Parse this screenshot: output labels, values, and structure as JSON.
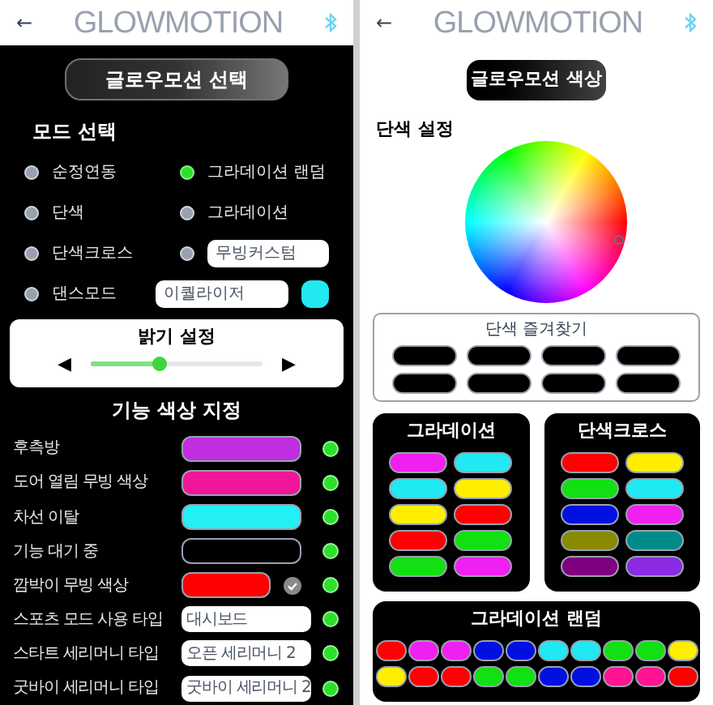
{
  "left": {
    "header": {
      "back": "←",
      "title": "GLOWMOTION"
    },
    "title": "글로우모션 선택",
    "mode_heading": "모드 선택",
    "modes": [
      {
        "kind": "text",
        "label": "순정연동",
        "selected": false
      },
      {
        "kind": "text",
        "label": "그라데이션 랜덤",
        "selected": true
      },
      {
        "kind": "text",
        "label": "단색",
        "selected": false
      },
      {
        "kind": "text",
        "label": "그라데이션",
        "selected": false
      },
      {
        "kind": "text",
        "label": "단색크로스",
        "selected": false
      },
      {
        "kind": "field",
        "value": "무빙커스텀",
        "selected": false
      },
      {
        "kind": "field_swatch",
        "label": "댄스모드",
        "value": "이퀄라이저",
        "color": "#22e8f2",
        "selected": false
      }
    ],
    "brightness": {
      "title": "밝기 설정",
      "left": "◀",
      "right": "▶",
      "level": 0.4
    },
    "function_heading": "기능 색상 지정",
    "functions": [
      {
        "label": "후측방",
        "kind": "swatch",
        "color": "#c02ee0",
        "on": true
      },
      {
        "label": "도어 열림 무빙 색상",
        "kind": "swatch",
        "color": "#f0169a",
        "on": true
      },
      {
        "label": "차선 이탈",
        "kind": "swatch",
        "color": "#22f0f5",
        "on": true
      },
      {
        "label": "기능 대기 중",
        "kind": "swatch",
        "color": "#000000",
        "on": true
      },
      {
        "label": "깜박이 무빙 색상",
        "kind": "swatch_check",
        "color": "#ff0000",
        "on": true
      },
      {
        "label": "스포츠 모드 사용 타입",
        "kind": "field",
        "value": "대시보드",
        "on": true
      },
      {
        "label": "스타트 세리머니 타입",
        "kind": "field",
        "value": "오픈 세리머니 2",
        "on": true
      },
      {
        "label": "굿바이 세리머니 타입",
        "kind": "field",
        "value": "굿바이 세리머니 2",
        "on": true
      }
    ]
  },
  "right": {
    "header": {
      "back": "←",
      "title": "GLOWMOTION"
    },
    "title": "글로우모션 색상",
    "solid_heading": "단색 설정",
    "favorites": {
      "title": "단색 즐겨찾기",
      "slots": [
        {
          "color": "#000000"
        },
        {
          "color": "#000000"
        },
        {
          "color": "#000000"
        },
        {
          "color": "#000000"
        },
        {
          "color": "#000000"
        },
        {
          "color": "#000000"
        },
        {
          "color": "#000000"
        },
        {
          "color": "#000000"
        }
      ]
    },
    "gradient": {
      "title": "그라데이션",
      "swatches": [
        {
          "color": "#f020f0"
        },
        {
          "color": "#22e8f2"
        },
        {
          "color": "#22e8f2"
        },
        {
          "color": "#ffee00"
        },
        {
          "color": "#ffee00"
        },
        {
          "color": "#ff0000"
        },
        {
          "color": "#ff0000"
        },
        {
          "color": "#12e012"
        },
        {
          "color": "#12e012"
        },
        {
          "color": "#f020f0"
        }
      ]
    },
    "cross": {
      "title": "단색크로스",
      "swatches": [
        {
          "color": "#ff0000"
        },
        {
          "color": "#ffee00"
        },
        {
          "color": "#12e012"
        },
        {
          "color": "#22e8f2"
        },
        {
          "color": "#0010e0"
        },
        {
          "color": "#f020f0"
        },
        {
          "color": "#8a8a00"
        },
        {
          "color": "#008b8b"
        },
        {
          "color": "#800080"
        },
        {
          "color": "#8a2be2"
        }
      ]
    },
    "random": {
      "title": "그라데이션 랜덤",
      "swatches": [
        {
          "color": "#ff0000"
        },
        {
          "color": "#f020f0"
        },
        {
          "color": "#f020f0"
        },
        {
          "color": "#0010e0"
        },
        {
          "color": "#0010e0"
        },
        {
          "color": "#22e8f2"
        },
        {
          "color": "#22e8f2"
        },
        {
          "color": "#12e012"
        },
        {
          "color": "#12e012"
        },
        {
          "color": "#ffee00"
        },
        {
          "color": "#ffee00"
        },
        {
          "color": "#ff0000"
        },
        {
          "color": "#ff0000"
        },
        {
          "color": "#12e012"
        },
        {
          "color": "#12e012"
        },
        {
          "color": "#0010e0"
        },
        {
          "color": "#0010e0"
        },
        {
          "color": "#ff1493"
        },
        {
          "color": "#ff1493"
        },
        {
          "color": "#ff0000"
        }
      ]
    }
  }
}
